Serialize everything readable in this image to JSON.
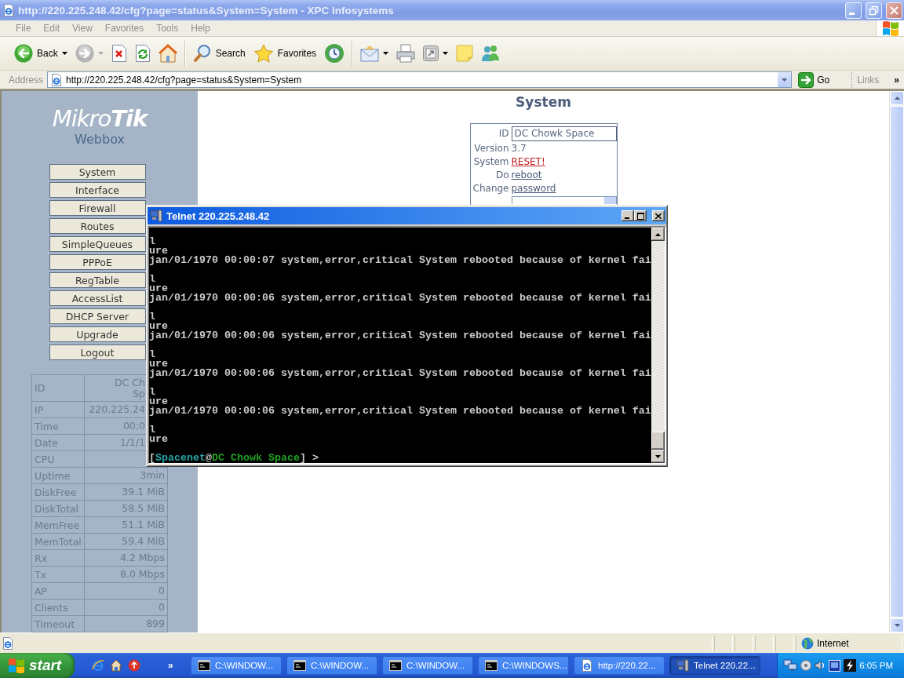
{
  "browser": {
    "title": "http://220.225.248.42/cfg?page=status&System=System - XPC Infosystems",
    "menu": [
      "File",
      "Edit",
      "View",
      "Favorites",
      "Tools",
      "Help"
    ],
    "toolbar": {
      "back": "Back",
      "forward_disabled": true,
      "search": "Search",
      "favorites": "Favorites"
    },
    "address": {
      "label": "Address",
      "url": "http://220.225.248.42/cfg?page=status&System=System",
      "go": "Go",
      "links": "Links",
      "more": "»"
    },
    "status_bar": {
      "zone": "Internet"
    }
  },
  "sidebar": {
    "logo": "Mikro**Tik**",
    "product": "Webbox",
    "nav": [
      "System",
      "Interface",
      "Firewall",
      "Routes",
      "SimpleQueues",
      "PPPoE",
      "RegTable",
      "AccessList",
      "DHCP Server",
      "Upgrade",
      "Logout"
    ],
    "status": [
      {
        "label": "ID",
        "kind": "cut",
        "value": "DC Ch\nSp"
      },
      {
        "label": "IP",
        "kind": "cut",
        "value": "220.225.24"
      },
      {
        "label": "Time",
        "kind": "cut",
        "value": "00:0"
      },
      {
        "label": "Date",
        "kind": "cut",
        "value": "1/1/1"
      },
      {
        "label": "CPU"
      },
      {
        "label": "Uptime",
        "kind": "plain",
        "value": "3min"
      },
      {
        "label": "DiskFree",
        "kind": "plain",
        "value": "39.1 MiB"
      },
      {
        "label": "DiskTotal",
        "kind": "plain",
        "value": "58.5 MiB"
      },
      {
        "label": "MemFree",
        "kind": "plain",
        "value": "51.1 MiB"
      },
      {
        "label": "MemTotal",
        "kind": "plain",
        "value": "59.4 MiB"
      },
      {
        "label": "Rx",
        "kind": "plain",
        "value": "4.2 Mbps"
      },
      {
        "label": "Tx",
        "kind": "plain",
        "value": "8.0 Mbps"
      },
      {
        "label": "AP",
        "kind": "plain",
        "value": "0"
      },
      {
        "label": "Clients",
        "kind": "plain",
        "value": "0"
      },
      {
        "label": "Timeout",
        "kind": "plain",
        "value": "899"
      }
    ]
  },
  "system_panel": {
    "heading": "System",
    "rows": [
      {
        "label": "ID",
        "kind": "input",
        "value": "DC Chowk Space"
      },
      {
        "label": "Version",
        "kind": "text",
        "value": "3.7"
      },
      {
        "label": "System",
        "kind": "danger_link",
        "value": "RESET!"
      },
      {
        "label": "Do",
        "kind": "link",
        "value": "reboot"
      },
      {
        "label": "Change",
        "kind": "link",
        "value": "password"
      },
      {
        "kind": "select"
      }
    ]
  },
  "telnet": {
    "title": "Telnet 220.225.248.42",
    "blocks": [
      [
        "l",
        "ure",
        "jan/01/1970 00:00:07 system,error,critical System rebooted because of kernel fai"
      ],
      [
        "l",
        "ure",
        "jan/01/1970 00:00:06 system,error,critical System rebooted because of kernel fai"
      ],
      [
        "l",
        "ure",
        "jan/01/1970 00:00:06 system,error,critical System rebooted because of kernel fai"
      ],
      [
        "l",
        "ure",
        "jan/01/1970 00:00:06 system,error,critical System rebooted because of kernel fai"
      ],
      [
        "l",
        "ure",
        "jan/01/1970 00:00:06 system,error,critical System rebooted because of kernel fai"
      ],
      [
        "l",
        "ure"
      ]
    ],
    "prompt": {
      "open": "[",
      "user": "Spacenet",
      "at": "@",
      "host": "DC Chowk Space",
      "close": "] >"
    }
  },
  "taskbar": {
    "start": "start",
    "quick_launch_more": "»",
    "tasks": [
      {
        "label": "C:\\WINDOW...",
        "kind": "console",
        "selected": false
      },
      {
        "label": "C:\\WINDOW...",
        "kind": "console",
        "selected": false
      },
      {
        "label": "C:\\WINDOW...",
        "kind": "console",
        "selected": false
      },
      {
        "label": "C:\\WINDOWS...",
        "kind": "console",
        "selected": false
      },
      {
        "label": "http://220.22...",
        "kind": "browser",
        "selected": false
      },
      {
        "label": "Telnet 220.22...",
        "kind": "telnet",
        "selected": true
      }
    ],
    "clock": "6:05 PM"
  }
}
